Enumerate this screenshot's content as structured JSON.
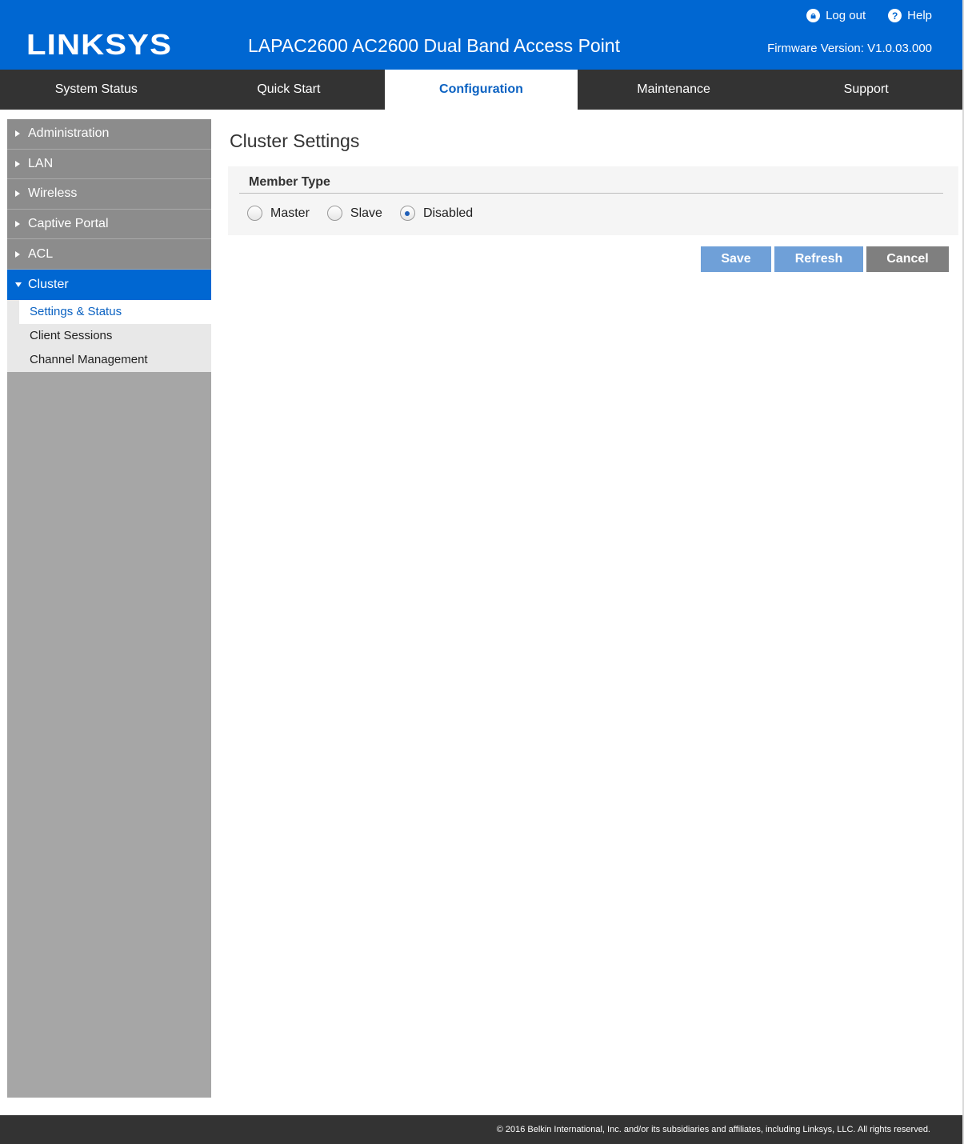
{
  "header": {
    "logo_text": "LINKSYS",
    "product_title": "LAPAC2600 AC2600 Dual Band Access Point",
    "logout_label": "Log out",
    "help_label": "Help",
    "firmware_label": "Firmware Version: V1.0.03.000",
    "brand_color": "#0067d2"
  },
  "nav": {
    "tabs": [
      {
        "label": "System Status"
      },
      {
        "label": "Quick Start"
      },
      {
        "label": "Configuration",
        "active": true
      },
      {
        "label": "Maintenance"
      },
      {
        "label": "Support"
      }
    ]
  },
  "sidebar": {
    "items": [
      {
        "label": "Administration"
      },
      {
        "label": "LAN"
      },
      {
        "label": "Wireless"
      },
      {
        "label": "Captive Portal"
      },
      {
        "label": "ACL"
      },
      {
        "label": "Cluster",
        "expanded": true
      }
    ],
    "sub_items": [
      {
        "label": "Settings & Status",
        "active": true
      },
      {
        "label": "Client Sessions"
      },
      {
        "label": "Channel Management"
      }
    ]
  },
  "main": {
    "page_title": "Cluster Settings",
    "member_type": {
      "heading": "Member Type",
      "options": [
        {
          "label": "Master",
          "checked": false
        },
        {
          "label": "Slave",
          "checked": false
        },
        {
          "label": "Disabled",
          "checked": true
        }
      ]
    },
    "buttons": {
      "save": "Save",
      "refresh": "Refresh",
      "cancel": "Cancel"
    }
  },
  "footer": {
    "copyright": "© 2016 Belkin International, Inc. and/or its subsidiaries and affiliates, including Linksys, LLC. All rights reserved."
  }
}
